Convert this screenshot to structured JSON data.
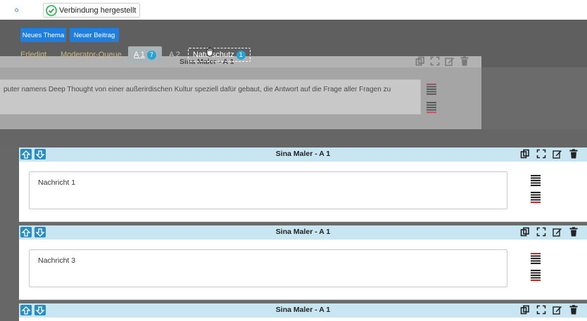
{
  "topbar": {
    "connection_status": "Verbindung hergestellt"
  },
  "toolbar": {
    "new_topic_label": "Neues Thema",
    "new_post_label": "Neuer Beitrag"
  },
  "tabs": [
    {
      "label": "Erledigt"
    },
    {
      "label": "Moderator-Queue"
    },
    {
      "label": "A 1",
      "badge": "7"
    },
    {
      "label": "A 2"
    },
    {
      "label": "Naturschutz",
      "badge": "1"
    }
  ],
  "dragged_post": {
    "title": "Sina Maler - A 1",
    "text": "puter namens Deep Thought von einer außerirdischen Kultur speziell dafür gebaut, die Antwort auf die Frage aller Fragen zu"
  },
  "posts": [
    {
      "title": "Sina Maler - A 1",
      "message": "Nachricht 1"
    },
    {
      "title": "Sina Maler - A 1",
      "message": "Nachricht 3"
    },
    {
      "title": "Sina Maler - A 1"
    }
  ],
  "icons": {
    "move_up": "arrow-up-icon",
    "move_down": "arrow-down-icon",
    "copy": "copy-icon",
    "expand": "expand-icon",
    "edit": "edit-icon",
    "delete": "trash-icon",
    "cursor": "grab-cursor-icon"
  },
  "colors": {
    "primary_button": "#1f7fe0",
    "post_header": "#c7e6f2",
    "badge": "#29a3d6",
    "tab_text": "#c9b98a",
    "check_green": "#19b24b"
  }
}
